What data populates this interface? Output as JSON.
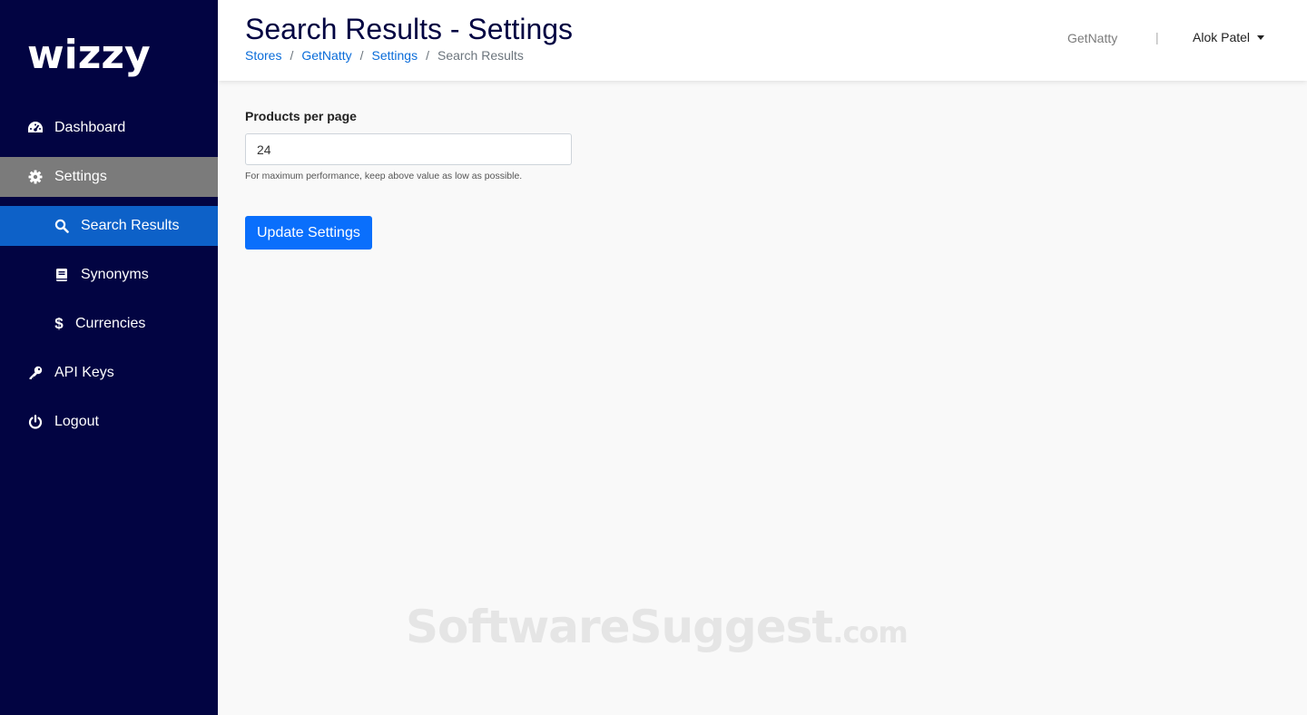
{
  "sidebar": {
    "logo": "wizzy",
    "items": [
      {
        "label": "Dashboard",
        "icon": "dashboard-icon"
      },
      {
        "label": "Settings",
        "icon": "gear-icon"
      },
      {
        "label": "Search Results",
        "icon": "search-icon"
      },
      {
        "label": "Synonyms",
        "icon": "book-icon"
      },
      {
        "label": "Currencies",
        "icon": "dollar-icon"
      },
      {
        "label": "API Keys",
        "icon": "key-icon"
      },
      {
        "label": "Logout",
        "icon": "power-icon"
      }
    ]
  },
  "header": {
    "title": "Search Results - Settings",
    "breadcrumb": {
      "stores": "Stores",
      "store": "GetNatty",
      "settings": "Settings",
      "current": "Search Results",
      "separator": "/"
    },
    "store_name": "GetNatty",
    "divider": "|",
    "user_name": "Alok Patel"
  },
  "form": {
    "products_label": "Products per page",
    "products_value": "24",
    "help_text": "For maximum performance, keep above value as low as possible.",
    "submit_label": "Update Settings"
  },
  "watermark": {
    "text": "SoftwareSuggest",
    "suffix": ".com"
  },
  "colors": {
    "sidebar_bg": "#020442",
    "settings_bg": "#7b7b7b",
    "active_bg": "#0d61c8",
    "primary": "#0a6ffc",
    "link": "#0a6cd9"
  }
}
